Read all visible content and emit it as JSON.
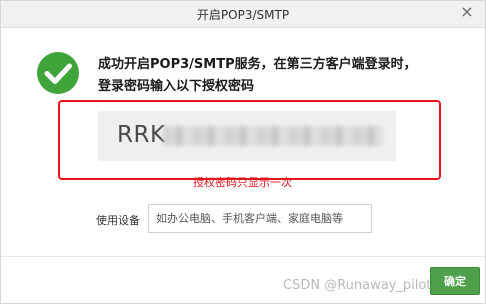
{
  "dialog": {
    "title": "开启POP3/SMTP",
    "close_glyph": "×",
    "message": "成功开启POP3/SMTP服务，在第三方客户端登录时，登录密码输入以下授权密码",
    "auth_code_visible": "RRK",
    "auth_code_hint": "授权密码只显示一次",
    "device": {
      "label": "使用设备",
      "placeholder": "如办公电脑、手机客户端、家庭电脑等",
      "value": ""
    },
    "confirm_label": "确定",
    "success_icon": "check-circle-icon"
  },
  "watermark": "CSDN @Runaway_pilot",
  "colors": {
    "success_green": "#3fa53b",
    "highlight_red": "#e4151d",
    "button_green": "#4ea04a"
  }
}
